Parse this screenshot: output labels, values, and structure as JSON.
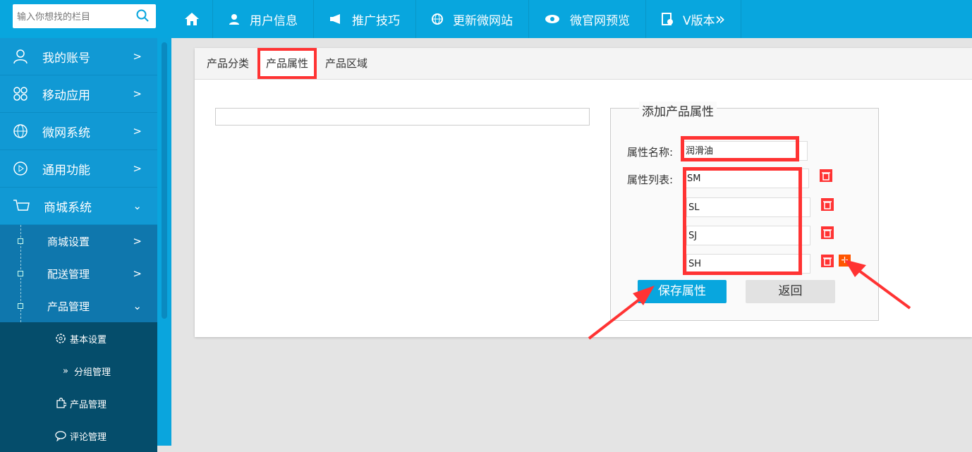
{
  "search": {
    "placeholder": "输入你想找的栏目"
  },
  "topnav": [
    {
      "label": "",
      "icon": "home-icon"
    },
    {
      "label": "用户信息",
      "icon": "user-icon"
    },
    {
      "label": "推广技巧",
      "icon": "megaphone-icon"
    },
    {
      "label": "更新微网站",
      "icon": "globe-icon"
    },
    {
      "label": "微官网预览",
      "icon": "eye-icon"
    },
    {
      "label": "V版本",
      "icon": "document-icon",
      "suffix": "»"
    }
  ],
  "sidebar": {
    "items": [
      {
        "label": "我的账号"
      },
      {
        "label": "移动应用"
      },
      {
        "label": "微网系统"
      },
      {
        "label": "通用功能"
      },
      {
        "label": "商城系统"
      }
    ],
    "sub": [
      {
        "label": "商城设置"
      },
      {
        "label": "配送管理"
      },
      {
        "label": "产品管理"
      }
    ],
    "subsub": [
      {
        "label": "基本设置"
      },
      {
        "label": "分组管理"
      },
      {
        "label": "产品管理"
      },
      {
        "label": "评论管理"
      }
    ]
  },
  "tabs": [
    {
      "label": "产品分类"
    },
    {
      "label": "产品属性"
    },
    {
      "label": "产品区域"
    }
  ],
  "form": {
    "legend": "添加产品属性",
    "name_label": "属性名称:",
    "name_value": "润滑油",
    "list_label": "属性列表:",
    "values": [
      "SM",
      "SL",
      "SJ",
      "SH"
    ],
    "save": "保存属性",
    "back": "返回"
  },
  "colors": {
    "primary": "#08a6de",
    "highlight": "#ff3333"
  }
}
